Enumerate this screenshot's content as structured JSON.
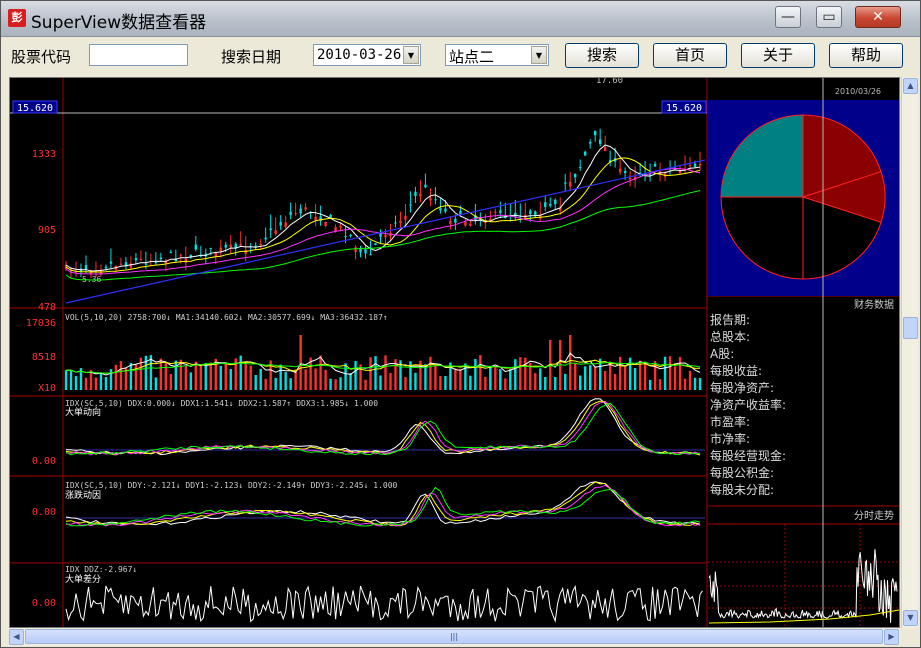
{
  "window": {
    "title": "SuperView数据查看器",
    "app_icon_glyph": "彭",
    "min_glyph": "—",
    "max_glyph": "▭",
    "close_glyph": "✕"
  },
  "toolbar": {
    "code_label": "股票代码",
    "code_value": "",
    "date_label": "搜索日期",
    "date_value": "2010-03-26",
    "site_value": "站点二",
    "search_label": "搜索",
    "home_label": "首页",
    "about_label": "关于",
    "help_label": "帮助"
  },
  "kline": {
    "price_tag_left": "15.620",
    "price_tag_right": "15.620",
    "high_tag": "17.60",
    "price_axis": [
      "1333",
      "905",
      "478"
    ],
    "ma_label": "5.36"
  },
  "volume": {
    "legend": "VOL(5,10,20) 2758:700↓ MA1:34140.602↓ MA2:30577.699↓ MA3:36432.187↑",
    "axis": [
      "17036",
      "8518",
      "X10"
    ]
  },
  "ind1": {
    "legend": "IDX(SC,5,10) DDX:0.000↓ DDX1:1.541↓ DDX2:1.587↑ DDX3:1.985↓ 1.000",
    "subtitle": "大单动向",
    "zero": "0.00"
  },
  "ind2": {
    "legend": "IDX(SC,5,10) DDY:-2.121↓ DDY1:-2.123↓ DDY2:-2.149↑ DDY3:-2.245↓ 1.000",
    "subtitle": "涨跌动因",
    "zero": "0.00"
  },
  "ind3": {
    "legend": "IDX DDZ:-2.967↓",
    "subtitle": "大单差分",
    "zero": "0.00"
  },
  "right_panel": {
    "top_date": "2010/03/26",
    "finance_title": "财务数据",
    "finance_rows": [
      "报告期:",
      "总股本:",
      "A股:",
      "每股收益:",
      "每股净资产:",
      "净资产收益率:",
      "市盈率:",
      "市净率:",
      "每股经营现金:",
      "每股公积金:",
      "每股未分配:"
    ],
    "intraday_title": "分时走势"
  },
  "pie": {
    "slices": [
      0.2,
      0.1,
      0.2,
      0.25,
      0.25
    ],
    "colors": [
      "#8b0000",
      "#8b0000",
      "#000000",
      "#000000",
      "#008080"
    ]
  },
  "colors": {
    "up": "#ff3030",
    "down": "#00e0e0",
    "ma5": "#ffffff",
    "ma10": "#ffff00",
    "ma20": "#ff30ff",
    "ma60": "#00ff00",
    "ma120": "#3030ff",
    "grid": "#a00000",
    "panel_bg": "#00008b"
  },
  "scroll": {
    "up": "▲",
    "down": "▼",
    "left": "◀",
    "right": "▶",
    "grip": "|||"
  }
}
